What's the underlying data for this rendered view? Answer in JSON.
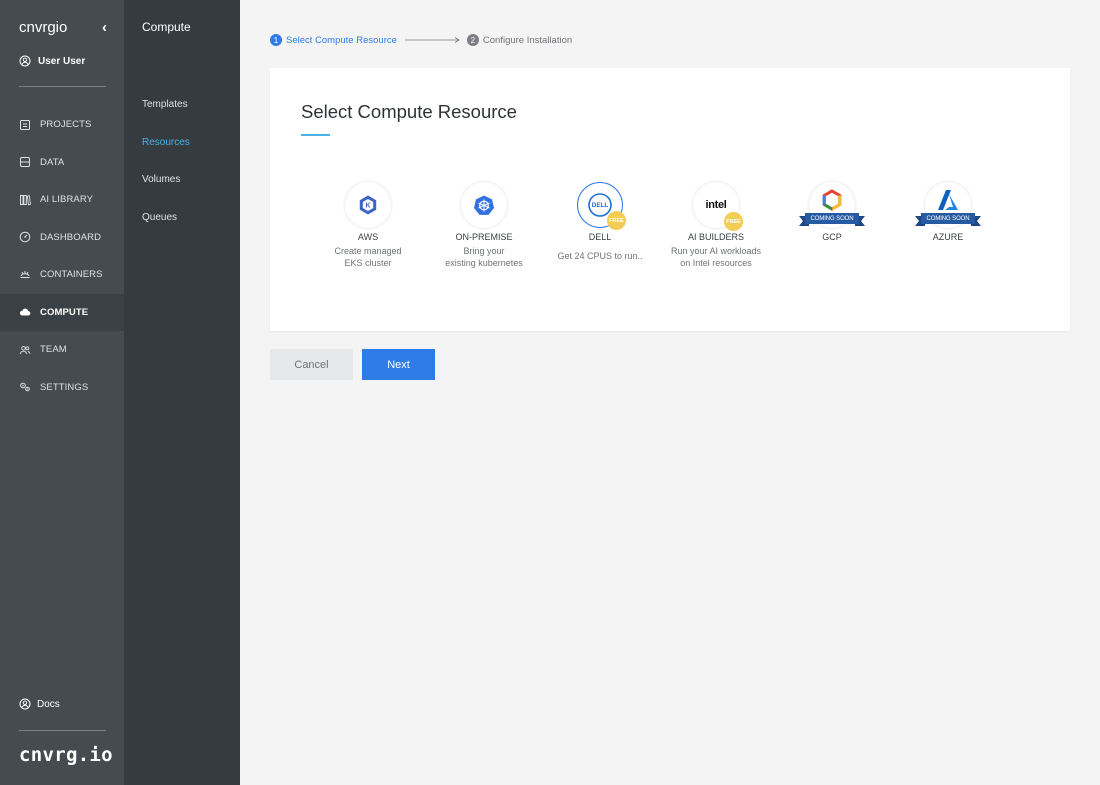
{
  "sidebar": {
    "brand": "cnvrgio",
    "collapse_glyph": "‹",
    "user_name": "User User",
    "items": [
      {
        "label": "PROJECTS",
        "icon": "projects-icon"
      },
      {
        "label": "DATA",
        "icon": "data-icon"
      },
      {
        "label": "AI LIBRARY",
        "icon": "ai-library-icon"
      },
      {
        "label": "DASHBOARD",
        "icon": "dashboard-icon"
      },
      {
        "label": "CONTAINERS",
        "icon": "containers-icon"
      },
      {
        "label": "COMPUTE",
        "icon": "cloud-icon",
        "active": true
      },
      {
        "label": "TEAM",
        "icon": "team-icon"
      },
      {
        "label": "SETTINGS",
        "icon": "settings-icon"
      }
    ],
    "docs_label": "Docs",
    "logo": "cnvrg.io"
  },
  "subnav": {
    "title": "Compute",
    "items": [
      {
        "label": "Templates"
      },
      {
        "label": "Resources",
        "active": true
      },
      {
        "label": "Volumes"
      },
      {
        "label": "Queues"
      }
    ]
  },
  "stepper": {
    "steps": [
      {
        "num": "1",
        "label": "Select Compute Resource",
        "active": true
      },
      {
        "num": "2",
        "label": "Configure Installation",
        "active": false
      }
    ]
  },
  "card": {
    "title": "Select Compute Resource",
    "resources": [
      {
        "name": "AWS",
        "desc1": "Create managed",
        "desc2": "EKS cluster",
        "icon": "eks-icon"
      },
      {
        "name": "ON-PREMISE",
        "desc1": "Bring your",
        "desc2": "existing kubernetes",
        "icon": "kubernetes-icon"
      },
      {
        "name": "DELL",
        "desc1": "Get 24 CPUS to run..",
        "icon": "dell-logo",
        "badge": "FREE",
        "selected": true
      },
      {
        "name": "AI BUILDERS",
        "desc1": "Run your AI workloads",
        "desc2": "on Intel resources",
        "icon": "intel-logo",
        "logo_text": "intel",
        "badge": "FREE"
      },
      {
        "name": "GCP",
        "icon": "gcp-icon",
        "ribbon": "COMING SOON"
      },
      {
        "name": "AZURE",
        "icon": "azure-icon",
        "ribbon": "COMING SOON"
      }
    ]
  },
  "buttons": {
    "cancel": "Cancel",
    "next": "Next"
  },
  "colors": {
    "accent": "#2f7ce8",
    "sidebar": "#454b4f",
    "subbar": "#353b3f",
    "active_link": "#4ab1e6",
    "free_badge": "#f3cc55",
    "ribbon": "#265ba3"
  }
}
